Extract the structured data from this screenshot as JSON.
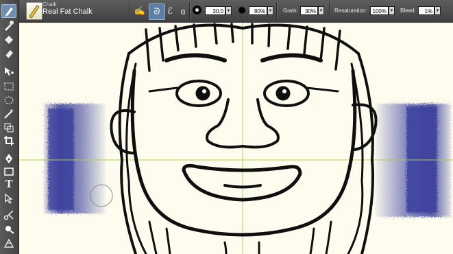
{
  "property_bar": {
    "brush_category": "Chalk",
    "brush_variant": "Real Fat Chalk",
    "size_value": "30.0",
    "opacity_value": "80%",
    "grain_label": "Grain:",
    "grain_value": "30%",
    "resaturation_label": "Resaturation:",
    "resaturation_value": "100%",
    "bleed_label": "Bleed:",
    "bleed_value": "1%"
  },
  "toolbox": {
    "tools": [
      "brush-tool",
      "dropper-tool",
      "paint-bucket-tool",
      "eraser-tool",
      "layer-adjuster-tool",
      "rectangular-selection-tool",
      "oval-selection-tool",
      "magic-wand-tool",
      "transform-tool",
      "crop-tool",
      "pen-tool",
      "rectangle-shape-tool",
      "text-tool",
      "selection-adjuster-tool",
      "scissors-tool",
      "divine-proportion-tool",
      "perspective-grid-tool"
    ]
  },
  "colors": {
    "chalk_blue": "#3b3f9c",
    "guide_green": "#a9cf58",
    "canvas": "#fdfcef",
    "active_tool": "#6f8fb0"
  }
}
